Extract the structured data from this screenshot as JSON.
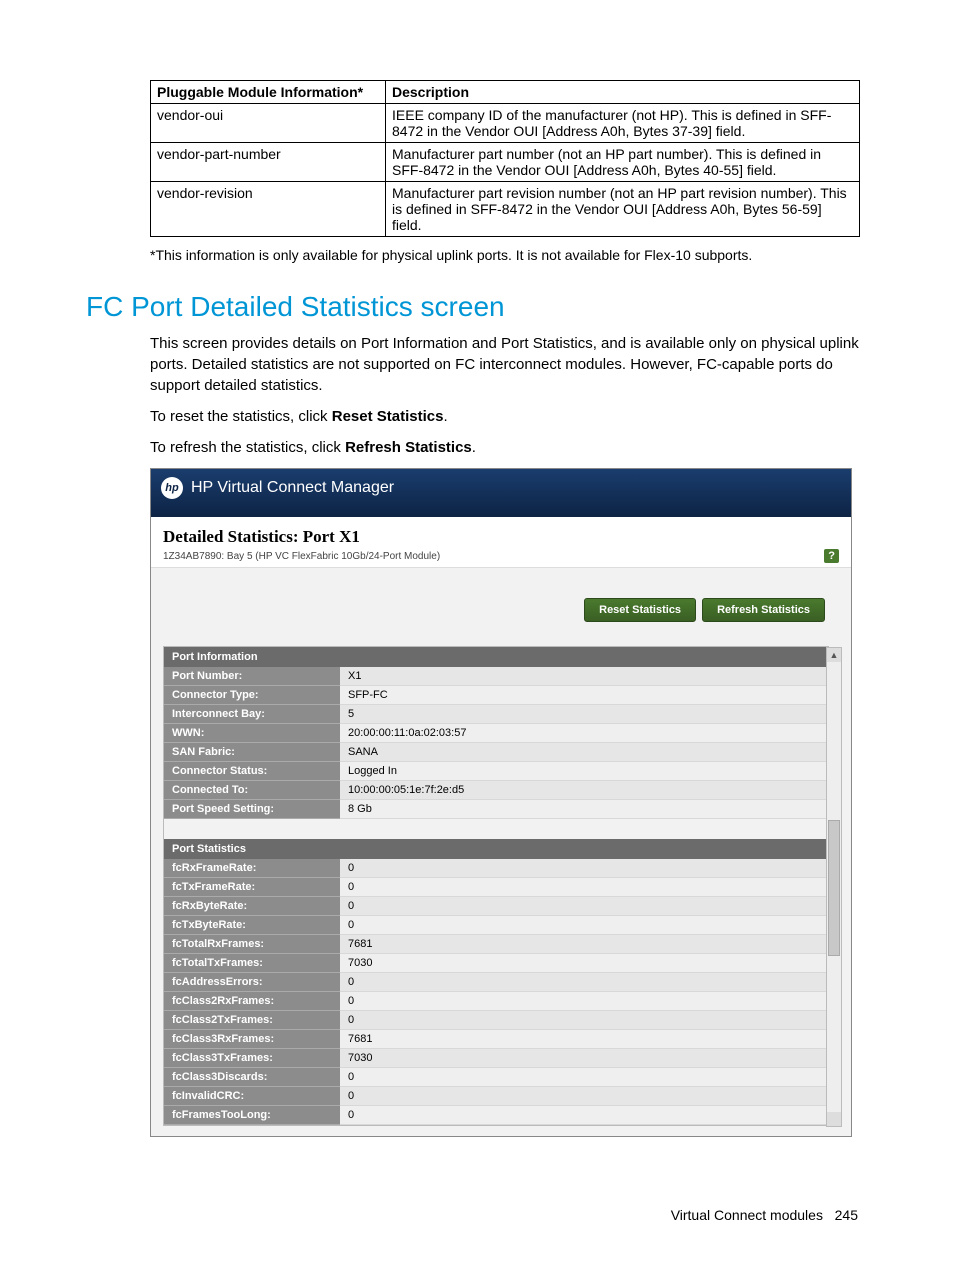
{
  "table": {
    "headers": [
      "Pluggable Module Information*",
      "Description"
    ],
    "rows": [
      {
        "k": "vendor-oui",
        "v": "IEEE company ID of the manufacturer (not HP). This is defined in SFF-8472 in the Vendor OUI [Address A0h, Bytes 37-39] field."
      },
      {
        "k": "vendor-part-number",
        "v": "Manufacturer part number (not an HP part number). This is defined in SFF-8472 in the Vendor OUI [Address A0h, Bytes 40-55] field."
      },
      {
        "k": "vendor-revision",
        "v": "Manufacturer part revision number (not an HP part revision number). This is defined in SFF-8472 in the Vendor OUI [Address A0h, Bytes 56-59] field."
      }
    ],
    "footnote": "*This information is only available for physical uplink ports. It is not available for Flex-10 subports."
  },
  "section_title": "FC Port Detailed Statistics screen",
  "para1": "This screen provides details on Port Information and Port Statistics, and is available only on physical uplink ports. Detailed statistics are not supported on FC interconnect modules. However, FC-capable ports do support detailed statistics.",
  "para2_pre": "To reset the statistics, click ",
  "para2_b": "Reset Statistics",
  "para3_pre": "To refresh the statistics, click ",
  "para3_b": "Refresh Statistics",
  "app": {
    "logo_text": "hp",
    "title": "HP Virtual Connect Manager",
    "header": "Detailed Statistics: Port X1",
    "crumb": "1Z34AB7890: Bay 5 (HP VC FlexFabric 10Gb/24-Port Module)",
    "help": "?",
    "btn_reset": "Reset Statistics",
    "btn_refresh": "Refresh Statistics",
    "port_info_header": "Port Information",
    "port_info": [
      {
        "k": "Port Number:",
        "v": "X1"
      },
      {
        "k": "Connector Type:",
        "v": "SFP-FC"
      },
      {
        "k": "Interconnect Bay:",
        "v": "5"
      },
      {
        "k": "WWN:",
        "v": "20:00:00:11:0a:02:03:57"
      },
      {
        "k": "SAN Fabric:",
        "v": "SANA"
      },
      {
        "k": "Connector Status:",
        "v": "Logged In"
      },
      {
        "k": "Connected To:",
        "v": "10:00:00:05:1e:7f:2e:d5"
      },
      {
        "k": "Port Speed Setting:",
        "v": "8 Gb"
      }
    ],
    "port_stats_header": "Port Statistics",
    "port_stats": [
      {
        "k": "fcRxFrameRate:",
        "v": "0"
      },
      {
        "k": "fcTxFrameRate:",
        "v": "0"
      },
      {
        "k": "fcRxByteRate:",
        "v": "0"
      },
      {
        "k": "fcTxByteRate:",
        "v": "0"
      },
      {
        "k": "fcTotalRxFrames:",
        "v": "7681"
      },
      {
        "k": "fcTotalTxFrames:",
        "v": "7030"
      },
      {
        "k": "fcAddressErrors:",
        "v": "0"
      },
      {
        "k": "fcClass2RxFrames:",
        "v": "0"
      },
      {
        "k": "fcClass2TxFrames:",
        "v": "0"
      },
      {
        "k": "fcClass3RxFrames:",
        "v": "7681"
      },
      {
        "k": "fcClass3TxFrames:",
        "v": "7030"
      },
      {
        "k": "fcClass3Discards:",
        "v": "0"
      },
      {
        "k": "fcInvalidCRC:",
        "v": "0"
      },
      {
        "k": "fcFramesTooLong:",
        "v": "0"
      }
    ]
  },
  "footer": "Virtual Connect modules   245"
}
